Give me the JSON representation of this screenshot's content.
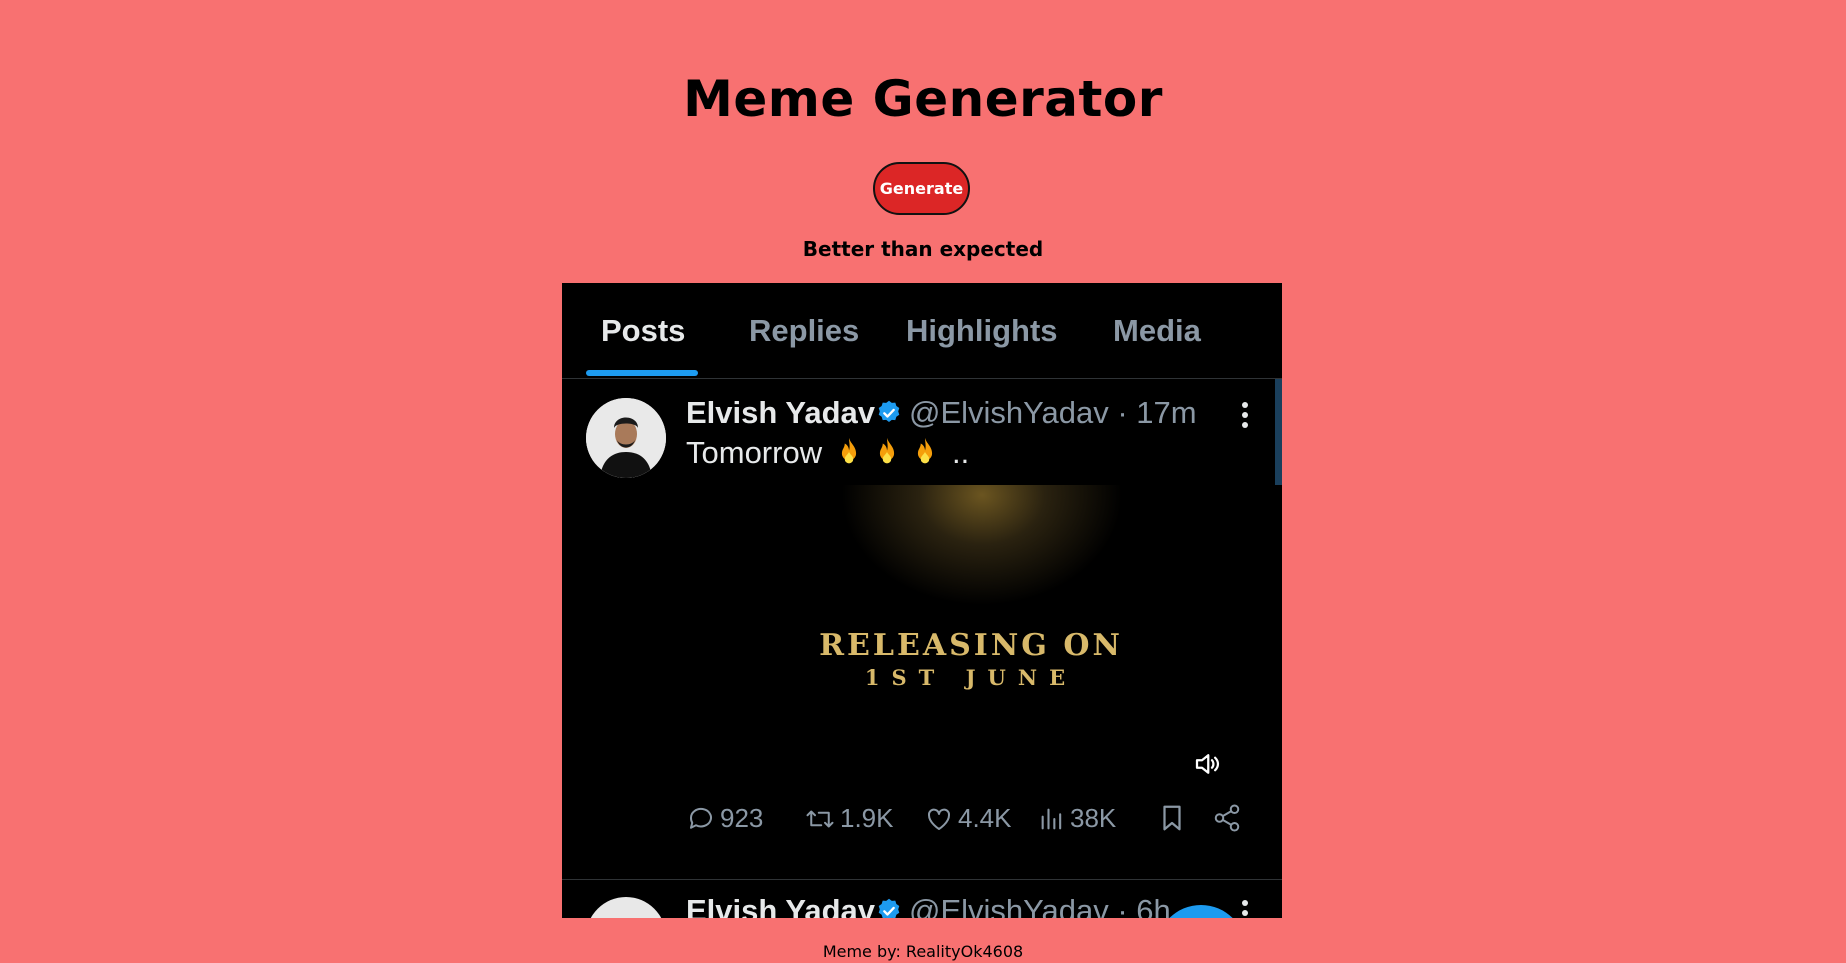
{
  "page": {
    "title": "Meme Generator",
    "generate_label": "Generate",
    "caption": "Better than expected",
    "credit": "Meme by: RealityOk4608"
  },
  "meme": {
    "tabs": [
      {
        "label": "Posts",
        "active": true
      },
      {
        "label": "Replies",
        "active": false
      },
      {
        "label": "Highlights",
        "active": false
      },
      {
        "label": "Media",
        "active": false
      }
    ],
    "post": {
      "name": "Elvish Yadav",
      "handle": "@ElvishYadav · 17m",
      "text": "Tomorrow",
      "text_suffix": "..",
      "emoji": [
        "fire-icon",
        "fire-icon",
        "fire-icon"
      ],
      "media_line1": "RELEASING ON",
      "media_line2": "1ST JUNE",
      "actions": {
        "replies": "923",
        "reposts": "1.9K",
        "likes": "4.4K",
        "views": "38K"
      }
    },
    "next_post": {
      "name": "Elvish Yadav",
      "handle": "@ElvishYadav · 6h"
    }
  },
  "colors": {
    "background": "#f87171",
    "button": "#dc2626",
    "accent": "#1d9bf0"
  }
}
